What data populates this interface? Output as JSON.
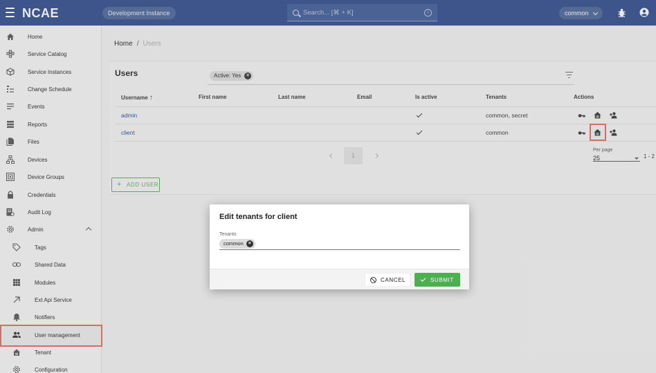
{
  "header": {
    "logo": "NCAE",
    "environment": "Development Instance",
    "search_placeholder": "Search... [⌘ + K]",
    "tenant": "common",
    "accent_color": "#2d4a8a"
  },
  "sidebar": {
    "items": [
      {
        "label": "Home",
        "icon": "home-icon"
      },
      {
        "label": "Service Catalog",
        "icon": "service-catalog-icon"
      },
      {
        "label": "Service Instances",
        "icon": "cube-icon"
      },
      {
        "label": "Change Schedule",
        "icon": "schedule-icon"
      },
      {
        "label": "Events",
        "icon": "events-icon"
      },
      {
        "label": "Reports",
        "icon": "reports-icon"
      },
      {
        "label": "Files",
        "icon": "files-icon"
      },
      {
        "label": "Devices",
        "icon": "devices-icon"
      },
      {
        "label": "Device Groups",
        "icon": "device-groups-icon"
      },
      {
        "label": "Credentials",
        "icon": "lock-icon"
      },
      {
        "label": "Audit Log",
        "icon": "audit-log-icon"
      },
      {
        "label": "Admin",
        "icon": "gear-icon"
      }
    ],
    "admin_items": [
      {
        "label": "Tags",
        "icon": "tag-icon"
      },
      {
        "label": "Shared Data",
        "icon": "link-icon"
      },
      {
        "label": "Modules",
        "icon": "modules-icon"
      },
      {
        "label": "Ext Api Service",
        "icon": "arrow-up-right-icon"
      },
      {
        "label": "Notifiers",
        "icon": "bell-icon"
      },
      {
        "label": "User management",
        "icon": "people-icon"
      },
      {
        "label": "Tenant",
        "icon": "tenant-icon"
      },
      {
        "label": "Configuration",
        "icon": "gear-icon"
      }
    ]
  },
  "breadcrumb": {
    "home": "Home",
    "separator": "/",
    "current": "Users"
  },
  "users": {
    "title": "Users",
    "filter_chip": "Active: Yes",
    "columns": [
      "Username",
      "First name",
      "Last name",
      "Email",
      "Is active",
      "Tenants",
      "Actions"
    ],
    "rows": [
      {
        "username": "admin",
        "first_name": "",
        "last_name": "",
        "email": "",
        "is_active": true,
        "tenants": "common, secret"
      },
      {
        "username": "client",
        "first_name": "",
        "last_name": "",
        "email": "",
        "is_active": true,
        "tenants": "common"
      }
    ],
    "pagination": {
      "page": "1",
      "per_page_label": "Per page",
      "per_page": "25",
      "range": "1 - 2"
    },
    "add_button": "ADD USER"
  },
  "dialog": {
    "title": "Edit tenants for client",
    "field_label": "Tenants",
    "selected_tenant": "common",
    "cancel": "CANCEL",
    "submit": "SUBMIT",
    "submit_color": "#4caf50"
  },
  "highlight_color": "#e06a5a"
}
